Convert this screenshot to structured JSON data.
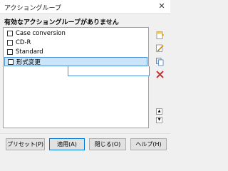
{
  "window": {
    "title": "アクショングループ",
    "close_glyph": "✕"
  },
  "notice": "有効なアクショングループがありません",
  "list": {
    "items": [
      {
        "label": "Case conversion",
        "checked": false
      },
      {
        "label": "CD-R",
        "checked": false
      },
      {
        "label": "Standard",
        "checked": false
      },
      {
        "label": "形式変更",
        "checked": false,
        "selected": true
      }
    ]
  },
  "side_toolbar": {
    "icons": [
      "new-icon",
      "edit-icon",
      "copy-icon",
      "delete-icon"
    ],
    "scroll": {
      "up_glyph": "▲",
      "down_glyph": "▼"
    }
  },
  "footer": {
    "preset": "プリセット(P)",
    "apply": "適用(A)",
    "close": "閉じる(O)",
    "help": "ヘルプ(H)"
  },
  "colors": {
    "selection": "#cce4f7",
    "selection_border": "#4a90d9",
    "delete_red": "#d03030"
  }
}
